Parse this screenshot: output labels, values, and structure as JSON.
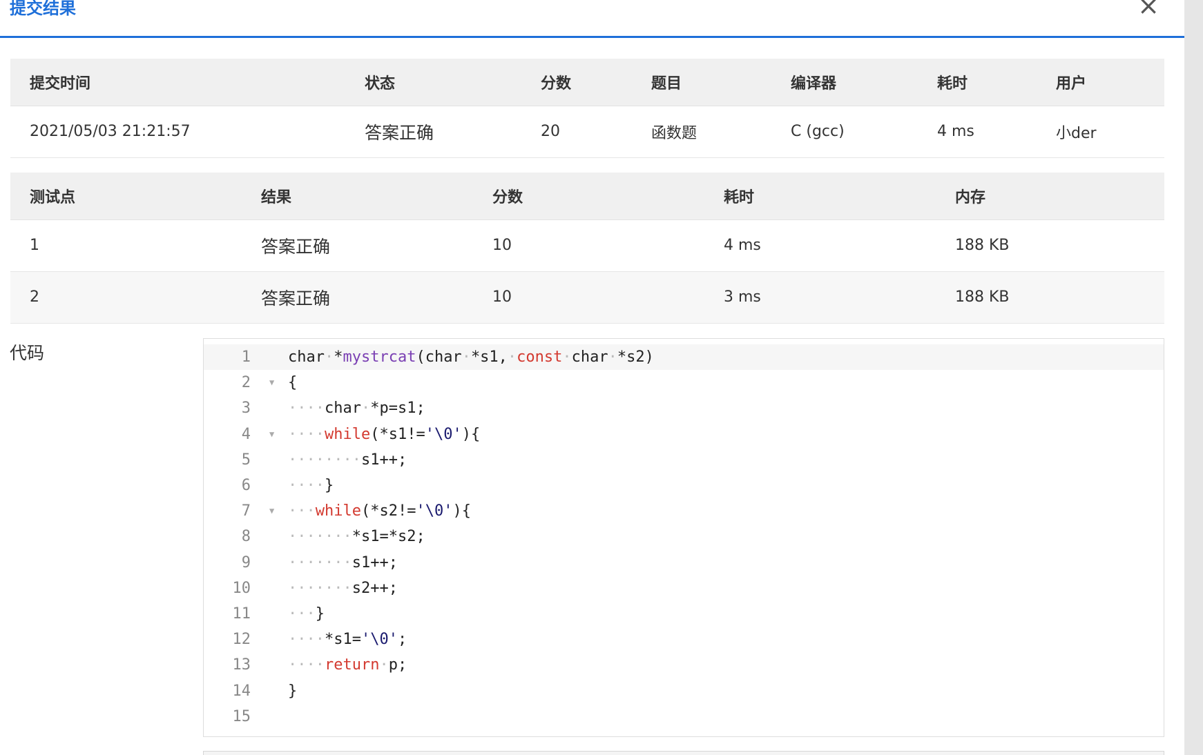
{
  "modal": {
    "title": "提交结果",
    "close_icon": "×"
  },
  "summary": {
    "headers": [
      "提交时间",
      "状态",
      "分数",
      "题目",
      "编译器",
      "耗时",
      "用户"
    ],
    "row": [
      "2021/05/03 21:21:57",
      "答案正确",
      "20",
      "函数题",
      "C (gcc)",
      "4 ms",
      "小der"
    ]
  },
  "cases": {
    "headers": [
      "测试点",
      "结果",
      "分数",
      "耗时",
      "内存"
    ],
    "rows": [
      [
        "1",
        "答案正确",
        "10",
        "4 ms",
        "188 KB"
      ],
      [
        "2",
        "答案正确",
        "10",
        "3 ms",
        "188 KB"
      ]
    ]
  },
  "code": {
    "label": "代码",
    "line_numbers": [
      "1",
      "2",
      "3",
      "4",
      "5",
      "6",
      "7",
      "8",
      "9",
      "10",
      "11",
      "12",
      "13",
      "14",
      "15"
    ],
    "lines": [
      "char *mystrcat(char *s1, const char *s2)",
      "{",
      "    char *p=s1;",
      "    while(*s1!='\\0'){",
      "        s1++;",
      "    }",
      "   while(*s2!='\\0'){",
      "       *s1=*s2;",
      "       s1++;",
      "       s2++;",
      "   }",
      "    *s1='\\0';",
      "    return p;",
      "}",
      ""
    ]
  },
  "colors": {
    "accent": "#1e6fd9",
    "status_ok": "#e5483a",
    "keyword": "#d3392f",
    "function": "#7a3fb3"
  }
}
